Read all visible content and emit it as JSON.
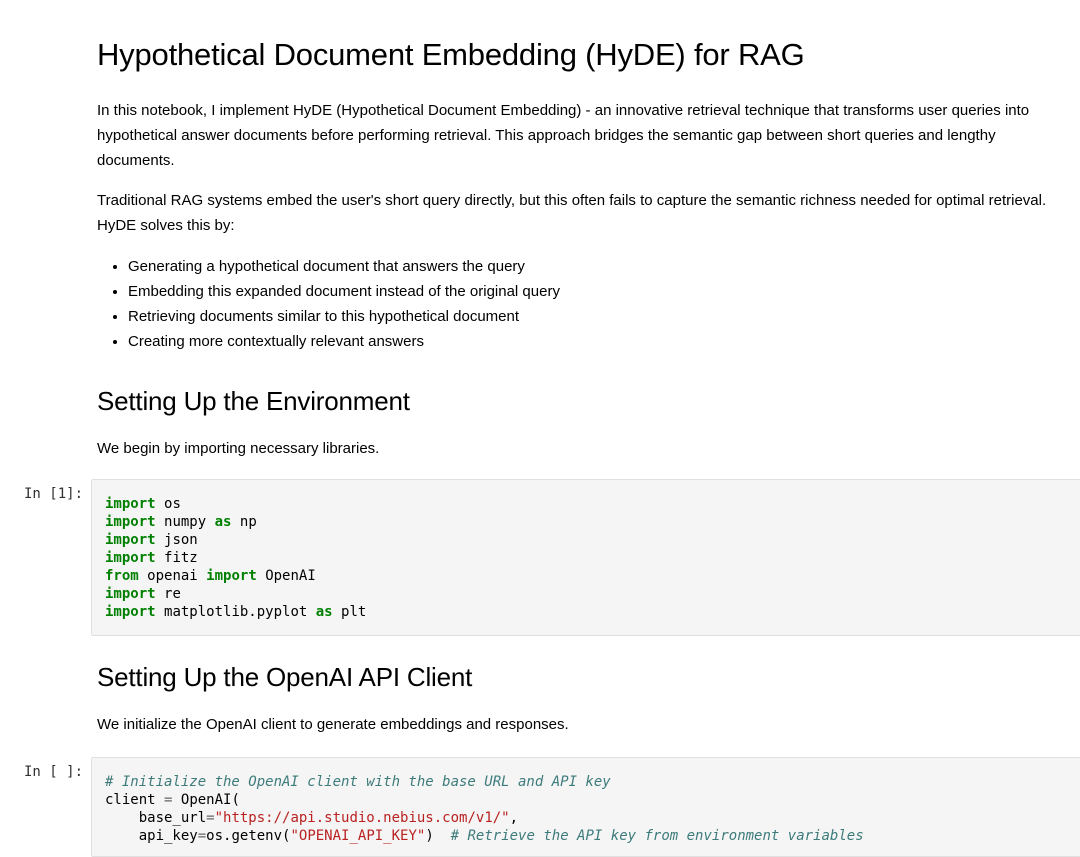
{
  "notebook": {
    "title": "Hypothetical Document Embedding (HyDE) for RAG",
    "intro_p1": "In this notebook, I implement HyDE (Hypothetical Document Embedding) - an innovative retrieval technique that transforms user queries into hypothetical answer documents before performing retrieval. This approach bridges the semantic gap between short queries and lengthy documents.",
    "intro_p2": "Traditional RAG systems embed the user's short query directly, but this often fails to capture the semantic richness needed for optimal retrieval. HyDE solves this by:",
    "bullets": [
      "Generating a hypothetical document that answers the query",
      "Embedding this expanded document instead of the original query",
      "Retrieving documents similar to this hypothetical document",
      "Creating more contextually relevant answers"
    ],
    "section1": {
      "heading": "Setting Up the Environment",
      "text": "We begin by importing necessary libraries."
    },
    "cell1": {
      "prompt": "In [1]:",
      "lines": [
        [
          "import",
          "os"
        ],
        [
          "import",
          "numpy",
          "as",
          "np"
        ],
        [
          "import",
          "json"
        ],
        [
          "import",
          "fitz"
        ],
        [
          "from",
          "openai",
          "import",
          "OpenAI"
        ],
        [
          "import",
          "re"
        ],
        [
          "import",
          "matplotlib.pyplot",
          "as",
          "plt"
        ]
      ]
    },
    "section2": {
      "heading": "Setting Up the OpenAI API Client",
      "text": "We initialize the OpenAI client to generate embeddings and responses."
    },
    "cell2": {
      "prompt": "In [ ]:",
      "comment": "# Initialize the OpenAI client with the base URL and API key",
      "client_var": "client",
      "client_call": "OpenAI(",
      "base_url_key": "base_url",
      "base_url_value": "\"https://api.studio.nebius.com/v1/\"",
      "api_key_key": "api_key",
      "api_key_call": "os.getenv(",
      "api_key_env": "\"OPENAI_API_KEY\"",
      "api_key_comment": "# Retrieve the API key from environment variables"
    }
  }
}
